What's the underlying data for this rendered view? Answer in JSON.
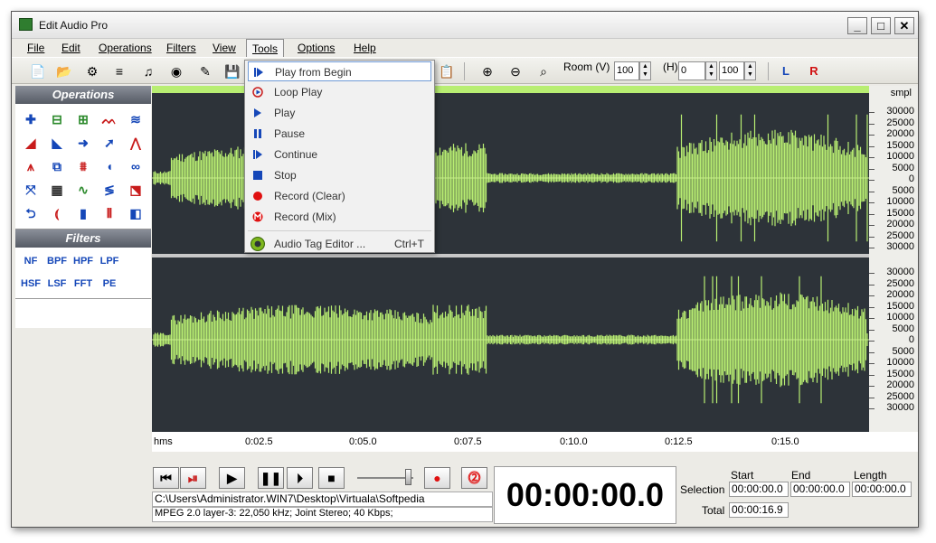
{
  "window": {
    "title": "Edit Audio Pro",
    "controls": [
      "_",
      "□",
      "✕"
    ]
  },
  "menubar": [
    {
      "label": "File"
    },
    {
      "label": "Edit"
    },
    {
      "label": "Operations"
    },
    {
      "label": "Filters"
    },
    {
      "label": "View"
    },
    {
      "label": "Tools"
    },
    {
      "label": "Options"
    },
    {
      "label": "Help"
    }
  ],
  "toolbar": {
    "room_label": "Room (V)",
    "room_v_value": "100",
    "h_label": "(H)",
    "h_value": "0",
    "h_zoom_value": "100",
    "left_channel": "L",
    "right_channel": "R"
  },
  "tools_menu": [
    {
      "label": "Play from Begin",
      "shortcut": "",
      "icon": "play-from-begin-icon"
    },
    {
      "label": "Loop Play",
      "shortcut": "",
      "icon": "loop-play-icon"
    },
    {
      "label": "Play",
      "shortcut": "",
      "icon": "play-icon"
    },
    {
      "label": "Pause",
      "shortcut": "",
      "icon": "pause-icon"
    },
    {
      "label": "Continue",
      "shortcut": "",
      "icon": "continue-icon"
    },
    {
      "label": "Stop",
      "shortcut": "",
      "icon": "stop-icon"
    },
    {
      "label": "Record (Clear)",
      "shortcut": "",
      "icon": "record-clear-icon"
    },
    {
      "label": "Record (Mix)",
      "shortcut": "",
      "icon": "record-mix-icon"
    },
    {
      "label": "Audio Tag Editor ...",
      "shortcut": "Ctrl+T",
      "icon": "audio-tag-editor-icon"
    }
  ],
  "sidebar": {
    "operations_title": "Operations",
    "filters_title": "Filters",
    "filters": [
      "NF",
      "BPF",
      "HPF",
      "LPF",
      "HSF",
      "LSF",
      "FFT",
      "PE"
    ]
  },
  "ruler": {
    "unit": "smpl",
    "channel1": [
      "30000",
      "25000",
      "20000",
      "15000",
      "10000",
      "5000",
      "0",
      "5000",
      "10000",
      "15000",
      "20000",
      "25000",
      "30000"
    ],
    "channel2": [
      "30000",
      "25000",
      "20000",
      "15000",
      "10000",
      "5000",
      "0",
      "5000",
      "10000",
      "15000",
      "20000",
      "25000",
      "30000"
    ]
  },
  "timeline": {
    "unit": "hms",
    "ticks": [
      "0:02.5",
      "0:05.0",
      "0:07.5",
      "0:10.0",
      "0:12.5",
      "0:15.0"
    ]
  },
  "status": {
    "file_path": "C:\\Users\\Administrator.WIN7\\Desktop\\Virtuala\\Softpedia",
    "format_info": "MPEG 2.0 layer-3: 22,050 kHz; Joint Stereo; 40 Kbps;",
    "clock": "00:00:00.0",
    "start_label": "Start",
    "end_label": "End",
    "length_label": "Length",
    "selection_label": "Selection",
    "selection_start": "00:00:00.0",
    "selection_end": "00:00:00.0",
    "selection_length": "00:00:00.0",
    "total_label": "Total",
    "total_value": "00:00:16.9"
  },
  "colors": {
    "waveform": "#b8ee72",
    "wave_bg": "#2d3339",
    "record": "#e01010",
    "filter_text": "#1547b8"
  }
}
